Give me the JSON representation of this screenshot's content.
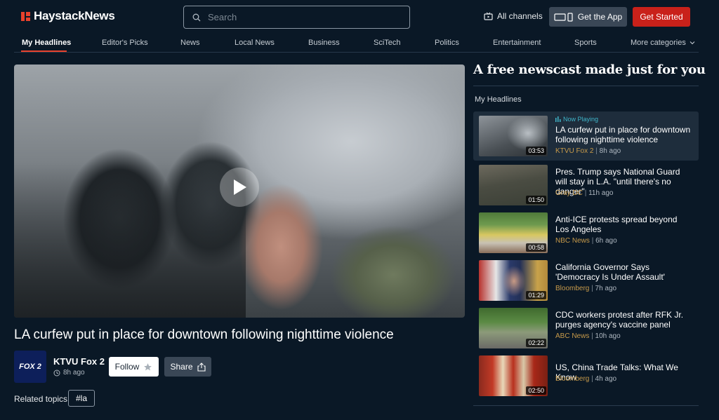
{
  "header": {
    "brand": "HaystackNews",
    "search_placeholder": "Search",
    "all_channels": "All channels",
    "get_app": "Get the App",
    "get_started": "Get Started"
  },
  "nav": {
    "items": [
      {
        "label": "My Headlines",
        "active": true
      },
      {
        "label": "Editor's Picks"
      },
      {
        "label": "News"
      },
      {
        "label": "Local News"
      },
      {
        "label": "Business"
      },
      {
        "label": "SciTech"
      },
      {
        "label": "Politics"
      },
      {
        "label": "Entertainment"
      },
      {
        "label": "Sports"
      },
      {
        "label": "More categories"
      }
    ]
  },
  "video": {
    "title": "LA curfew put in place for downtown following nighttime violence",
    "source_logo_text": "FOX 2",
    "source_name": "KTVU Fox 2",
    "time": "8h ago",
    "follow": "Follow",
    "share": "Share",
    "related_label": "Related topics",
    "topic": "#la"
  },
  "panel": {
    "heading": "A free newscast made just for you",
    "subheading": "My Headlines",
    "now_playing": "Now Playing",
    "items": [
      {
        "title": "LA curfew put in place for downtown following nighttime violence",
        "source": "KTVU Fox 2",
        "age": "8h ago",
        "duration": "03:53",
        "playing": true
      },
      {
        "title": "Pres. Trump says National Guard will stay in L.A. \"until there's no danger\"",
        "source": "Gray DC",
        "age": "11h ago",
        "duration": "01:50"
      },
      {
        "title": "Anti-ICE protests spread beyond Los Angeles",
        "source": "NBC News",
        "age": "6h ago",
        "duration": "00:58"
      },
      {
        "title": "California Governor Says 'Democracy Is Under Assault'",
        "source": "Bloomberg",
        "age": "7h ago",
        "duration": "01:29"
      },
      {
        "title": "CDC workers protest after RFK Jr. purges agency's vaccine panel",
        "source": "ABC News",
        "age": "10h ago",
        "duration": "02:22"
      },
      {
        "title": "US, China Trade Talks: What We Know",
        "source": "Bloomberg",
        "age": "4h ago",
        "duration": "02:50"
      }
    ]
  },
  "colors": {
    "background": "#0a1826",
    "accent_red": "#c9211a",
    "meta_gold": "#c79a4a",
    "now_playing_teal": "#3fb5c9"
  }
}
